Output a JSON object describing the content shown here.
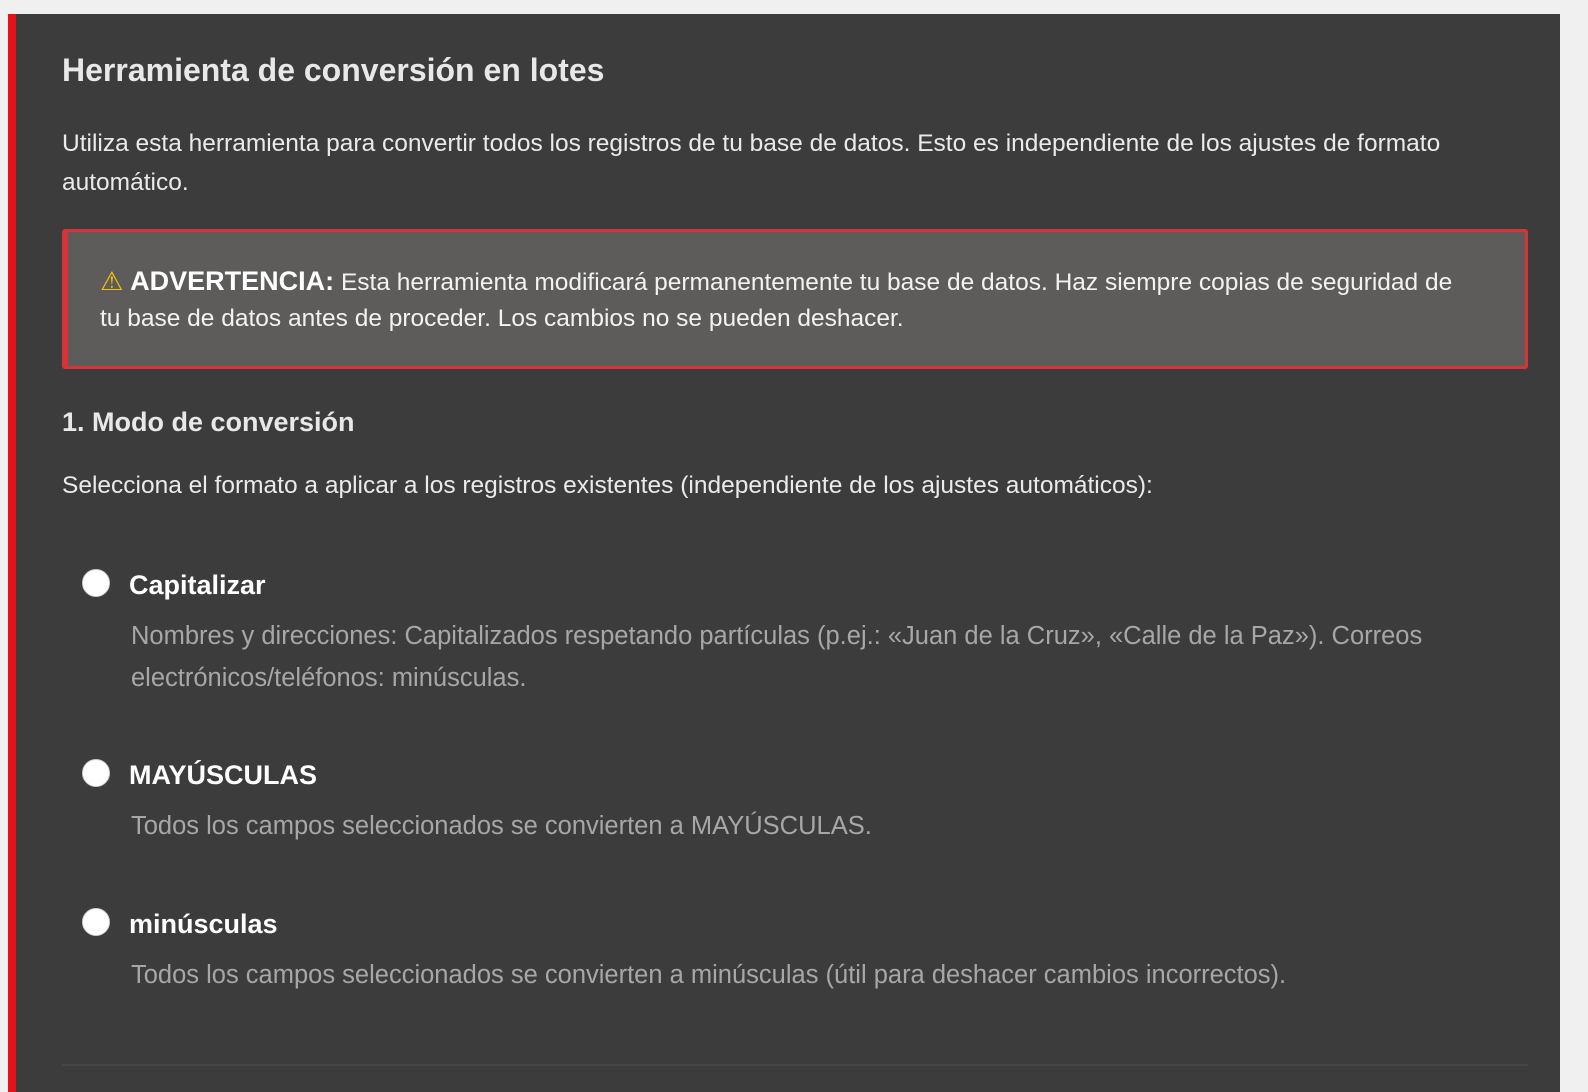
{
  "tool": {
    "title": "Herramienta de conversión en lotes",
    "intro": "Utiliza esta herramienta para convertir todos los registros de tu base de datos. Esto es independiente de los ajustes de formato automático.",
    "warning": {
      "icon": "⚠",
      "label": "ADVERTENCIA:",
      "text": "Esta herramienta modificará permanentemente tu base de datos. Haz siempre copias de seguridad de tu base de datos antes de proceder. Los cambios no se pueden deshacer."
    },
    "section": {
      "heading": "1. Modo de conversión",
      "description": "Selecciona el formato a aplicar a los registros existentes (independiente de los ajustes automáticos):"
    },
    "options": [
      {
        "label": "Capitalizar",
        "description": "Nombres y direcciones: Capitalizados respetando partículas (p.ej.: «Juan de la Cruz», «Calle de la Paz»). Correos electrónicos/teléfonos: minúsculas.",
        "selected": false
      },
      {
        "label": "MAYÚSCULAS",
        "description": "Todos los campos seleccionados se convierten a MAYÚSCULAS.",
        "selected": false
      },
      {
        "label": "minúsculas",
        "description": "Todos los campos seleccionados se convierten a minúsculas (útil para deshacer cambios incorrectos).",
        "selected": false
      }
    ]
  },
  "colors": {
    "accent": "#e3131b",
    "panel_background": "#3c3c3c",
    "warning_background": "#5d5c5b",
    "warning_border": "#d6333a",
    "warning_icon": "#f4c20d"
  }
}
